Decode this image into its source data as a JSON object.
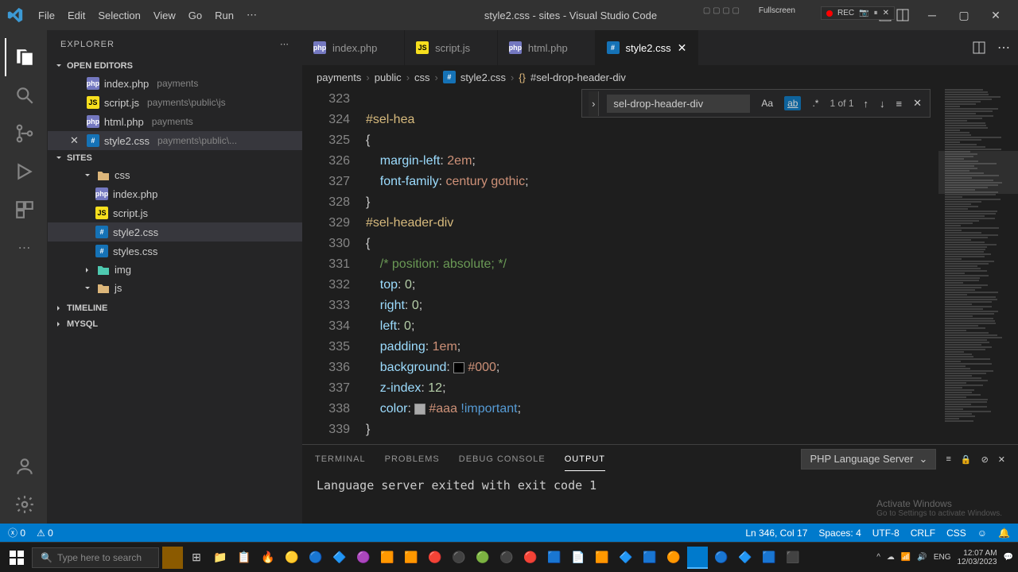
{
  "title": "style2.css - sites - Visual Studio Code",
  "menu": [
    "File",
    "Edit",
    "Selection",
    "View",
    "Go",
    "Run"
  ],
  "rec": {
    "label": "REC",
    "fullscreen": "Fullscreen"
  },
  "sidebar": {
    "title": "EXPLORER",
    "open_editors": "OPEN EDITORS",
    "editors": [
      {
        "name": "index.php",
        "path": "payments",
        "kind": "php",
        "active": false
      },
      {
        "name": "script.js",
        "path": "payments\\public\\js",
        "kind": "js",
        "active": false
      },
      {
        "name": "html.php",
        "path": "payments",
        "kind": "php",
        "active": false
      },
      {
        "name": "style2.css",
        "path": "payments\\public\\...",
        "kind": "css",
        "active": true
      }
    ],
    "workspace": "SITES",
    "tree": {
      "css_folder": "css",
      "files": [
        {
          "name": "index.php",
          "kind": "php"
        },
        {
          "name": "script.js",
          "kind": "js"
        },
        {
          "name": "style2.css",
          "kind": "css",
          "active": true
        },
        {
          "name": "styles.css",
          "kind": "css"
        }
      ],
      "img_folder": "img",
      "js_folder": "js"
    },
    "timeline": "TIMELINE",
    "mysql": "MYSQL"
  },
  "tabs": [
    {
      "name": "index.php",
      "kind": "php"
    },
    {
      "name": "script.js",
      "kind": "js"
    },
    {
      "name": "html.php",
      "kind": "php"
    },
    {
      "name": "style2.css",
      "kind": "css",
      "active": true
    }
  ],
  "breadcrumb": [
    "payments",
    "public",
    "css",
    "style2.css",
    "#sel-drop-header-div"
  ],
  "find": {
    "query": "sel-drop-header-div",
    "count": "1 of 1"
  },
  "code": {
    "lines": [
      {
        "n": 323,
        "txt": ""
      },
      {
        "n": 324,
        "sel": "#sel-hea"
      },
      {
        "n": 325,
        "brace": "{"
      },
      {
        "n": 326,
        "prop": "margin-left",
        "val": "2em"
      },
      {
        "n": 327,
        "prop": "font-family",
        "vals": [
          "century",
          "gothic"
        ]
      },
      {
        "n": 328,
        "brace": "}"
      },
      {
        "n": 329,
        "sel_full": "#sel-header-div"
      },
      {
        "n": 330,
        "brace": "{"
      },
      {
        "n": 331,
        "cmt": "/* position: absolute; */"
      },
      {
        "n": 332,
        "prop": "top",
        "num": "0"
      },
      {
        "n": 333,
        "prop": "right",
        "num": "0"
      },
      {
        "n": 334,
        "prop": "left",
        "num": "0"
      },
      {
        "n": 335,
        "prop": "padding",
        "val": "1em"
      },
      {
        "n": 336,
        "prop": "background",
        "color": "#000"
      },
      {
        "n": 337,
        "prop": "z-index",
        "num": "12"
      },
      {
        "n": 338,
        "prop": "color",
        "color": "#aaa",
        "imp": "!important"
      },
      {
        "n": 339,
        "brace": "}"
      }
    ]
  },
  "panel": {
    "tabs": [
      "TERMINAL",
      "PROBLEMS",
      "DEBUG CONSOLE",
      "OUTPUT"
    ],
    "active": "OUTPUT",
    "select": "PHP Language Server",
    "output": "Language server exited with exit code 1"
  },
  "statusbar": {
    "errors": "0",
    "warnings": "0",
    "cursor": "Ln 346, Col 17",
    "spaces": "Spaces: 4",
    "encoding": "UTF-8",
    "eol": "CRLF",
    "lang": "CSS"
  },
  "taskbar": {
    "search": "Type here to search",
    "time": "12:07 AM",
    "date": "12/03/2023"
  },
  "activate": {
    "title": "Activate Windows",
    "sub": "Go to Settings to activate Windows."
  }
}
